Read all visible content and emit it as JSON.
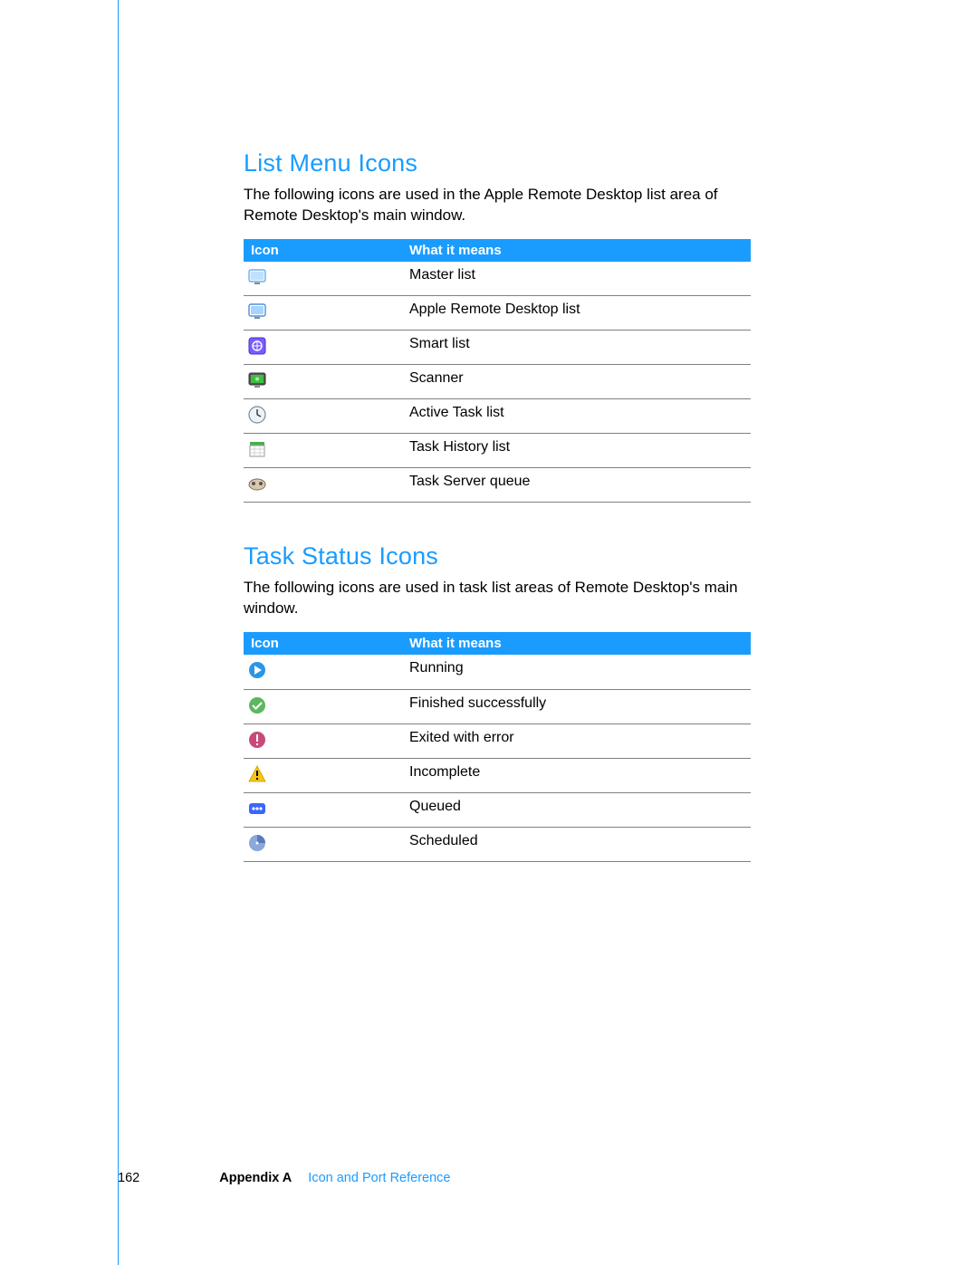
{
  "sections": [
    {
      "title": "List Menu Icons",
      "desc": "The following icons are used in the Apple Remote Desktop list area of Remote Desktop's main window.",
      "headers": {
        "icon": "Icon",
        "meaning": "What it means"
      },
      "rows": [
        {
          "icon": "master-list-icon",
          "meaning": "Master list"
        },
        {
          "icon": "ard-list-icon",
          "meaning": "Apple Remote Desktop list"
        },
        {
          "icon": "smart-list-icon",
          "meaning": "Smart list"
        },
        {
          "icon": "scanner-icon",
          "meaning": "Scanner"
        },
        {
          "icon": "active-task-icon",
          "meaning": "Active Task list"
        },
        {
          "icon": "task-history-icon",
          "meaning": "Task History list"
        },
        {
          "icon": "task-server-icon",
          "meaning": "Task Server queue"
        }
      ]
    },
    {
      "title": "Task Status Icons",
      "desc": "The following icons are used in task list areas of Remote Desktop's main window.",
      "headers": {
        "icon": "Icon",
        "meaning": "What it means"
      },
      "rows": [
        {
          "icon": "running-icon",
          "meaning": "Running"
        },
        {
          "icon": "finished-icon",
          "meaning": "Finished successfully"
        },
        {
          "icon": "error-icon",
          "meaning": "Exited with error"
        },
        {
          "icon": "incomplete-icon",
          "meaning": "Incomplete"
        },
        {
          "icon": "queued-icon",
          "meaning": "Queued"
        },
        {
          "icon": "scheduled-icon",
          "meaning": "Scheduled"
        }
      ]
    }
  ],
  "footer": {
    "page_number": "162",
    "appendix": "Appendix A",
    "title": "Icon and Port Reference"
  }
}
